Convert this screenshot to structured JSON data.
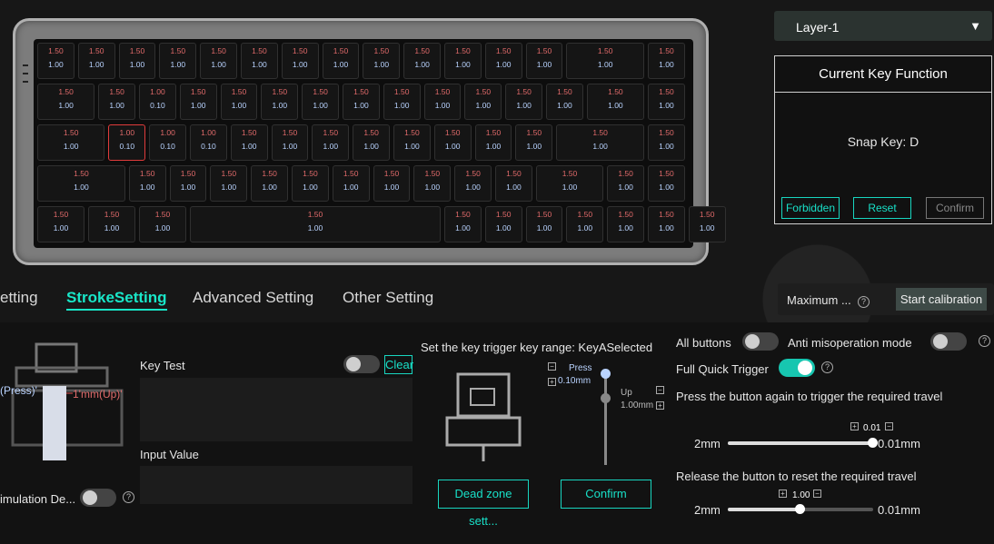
{
  "layer": {
    "selected": "Layer-1",
    "arrow": "▼"
  },
  "ckf": {
    "title": "Current Key Function",
    "snap": "Snap Key: D",
    "forbidden": "Forbidden",
    "reset": "Reset",
    "confirm": "Confirm"
  },
  "rows": [
    [
      [
        "1.50",
        "1.00"
      ],
      [
        "1.50",
        "1.00"
      ],
      [
        "1.50",
        "1.00"
      ],
      [
        "1.50",
        "1.00"
      ],
      [
        "1.50",
        "1.00"
      ],
      [
        "1.50",
        "1.00"
      ],
      [
        "1.50",
        "1.00"
      ],
      [
        "1.50",
        "1.00"
      ],
      [
        "1.50",
        "1.00"
      ],
      [
        "1.50",
        "1.00"
      ],
      [
        "1.50",
        "1.00"
      ],
      [
        "1.50",
        "1.00"
      ],
      [
        "1.50",
        "1.00"
      ],
      [
        "1.50",
        "1.00"
      ],
      [
        "1.50",
        "1.00"
      ]
    ],
    [
      [
        "1.50",
        "1.00"
      ],
      [
        "1.50",
        "1.00"
      ],
      [
        "1.00",
        "0.10"
      ],
      [
        "1.50",
        "1.00"
      ],
      [
        "1.50",
        "1.00"
      ],
      [
        "1.50",
        "1.00"
      ],
      [
        "1.50",
        "1.00"
      ],
      [
        "1.50",
        "1.00"
      ],
      [
        "1.50",
        "1.00"
      ],
      [
        "1.50",
        "1.00"
      ],
      [
        "1.50",
        "1.00"
      ],
      [
        "1.50",
        "1.00"
      ],
      [
        "1.50",
        "1.00"
      ],
      [
        "1.50",
        "1.00"
      ],
      [
        "1.50",
        "1.00"
      ]
    ],
    [
      [
        "1.50",
        "1.00"
      ],
      [
        "1.00",
        "0.10"
      ],
      [
        "1.00",
        "0.10"
      ],
      [
        "1.00",
        "0.10"
      ],
      [
        "1.50",
        "1.00"
      ],
      [
        "1.50",
        "1.00"
      ],
      [
        "1.50",
        "1.00"
      ],
      [
        "1.50",
        "1.00"
      ],
      [
        "1.50",
        "1.00"
      ],
      [
        "1.50",
        "1.00"
      ],
      [
        "1.50",
        "1.00"
      ],
      [
        "1.50",
        "1.00"
      ],
      [
        "1.50",
        "1.00"
      ],
      [
        "1.50",
        "1.00"
      ]
    ],
    [
      [
        "1.50",
        "1.00"
      ],
      [
        "1.50",
        "1.00"
      ],
      [
        "1.50",
        "1.00"
      ],
      [
        "1.50",
        "1.00"
      ],
      [
        "1.50",
        "1.00"
      ],
      [
        "1.50",
        "1.00"
      ],
      [
        "1.50",
        "1.00"
      ],
      [
        "1.50",
        "1.00"
      ],
      [
        "1.50",
        "1.00"
      ],
      [
        "1.50",
        "1.00"
      ],
      [
        "1.50",
        "1.00"
      ],
      [
        "1.50",
        "1.00"
      ],
      [
        "1.50",
        "1.00"
      ],
      [
        "1.50",
        "1.00"
      ]
    ],
    [
      [
        "1.50",
        "1.00"
      ],
      [
        "1.50",
        "1.00"
      ],
      [
        "1.50",
        "1.00"
      ],
      [
        "1.50",
        "1.00"
      ],
      [
        "1.50",
        "1.00"
      ],
      [
        "1.50",
        "1.00"
      ],
      [
        "1.50",
        "1.00"
      ],
      [
        "1.50",
        "1.00"
      ],
      [
        "1.50",
        "1.00"
      ],
      [
        "1.50",
        "1.00"
      ],
      [
        "1.50",
        "1.00"
      ]
    ]
  ],
  "tabs": [
    "etting",
    "StrokeSetting",
    "Advanced Setting",
    "Other Setting"
  ],
  "maximum": {
    "label": "Maximum ...",
    "calibrate": "Start calibration"
  },
  "left": {
    "keytest": "Key Test",
    "clear": "Clear",
    "inputvalue": "Input Value",
    "press": "(Press)'",
    "up": "1'mm(Up)'",
    "simulation": "imulation De..."
  },
  "mid": {
    "title": "Set the key trigger key range: KeyASelected",
    "press": "Press",
    "pressval": "0.10mm",
    "up": "Up",
    "upval": "1.00mm",
    "deadzone": "Dead zone sett...",
    "confirm": "Confirm"
  },
  "right": {
    "allbuttons": "All buttons",
    "anti": "Anti misoperation mode",
    "fqt": "Full Quick Trigger",
    "pressagain": "Press the button again to trigger the required travel",
    "release": "Release the button to reset the required travel",
    "min1": "2mm",
    "max1": "0.01mm",
    "val1": "0.01",
    "min2": "2mm",
    "max2": "0.01mm",
    "val2": "1.00",
    "pos1": 1.0,
    "pos2": 0.5
  }
}
